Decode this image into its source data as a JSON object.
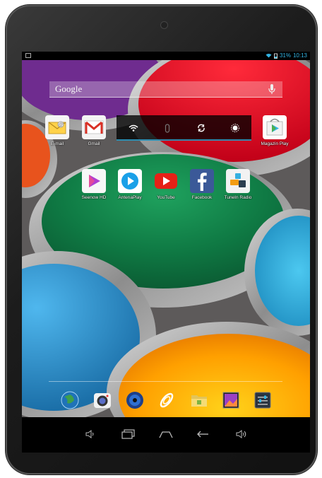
{
  "status_bar": {
    "battery": "31%",
    "time": "10:13"
  },
  "search": {
    "label": "Google"
  },
  "quick_settings": [
    "wifi-icon",
    "bluetooth-icon",
    "sync-icon",
    "brightness-icon"
  ],
  "top_apps": [
    {
      "label": "E-mail",
      "icon": "email-icon"
    },
    {
      "label": "Gmail",
      "icon": "gmail-icon"
    },
    {
      "label": "Magazin Play",
      "icon": "play-store-icon"
    }
  ],
  "apps": [
    {
      "label": "Seenow HD",
      "icon": "seenow-icon"
    },
    {
      "label": "AntenaPlay",
      "icon": "antenaplay-icon"
    },
    {
      "label": "YouTube",
      "icon": "youtube-icon"
    },
    {
      "label": "Facebook",
      "icon": "facebook-icon"
    },
    {
      "label": "TuneIn Radio",
      "icon": "tunein-icon"
    }
  ],
  "dock": [
    "browser-icon",
    "camera-icon",
    "music-icon",
    "launcher-icon",
    "file-manager-icon",
    "gallery-icon",
    "settings-icon"
  ],
  "navigation": [
    "volume-down-icon",
    "recent-apps-icon",
    "home-icon",
    "back-icon",
    "volume-up-icon"
  ],
  "colors": {
    "accent": "#33b5e5"
  }
}
